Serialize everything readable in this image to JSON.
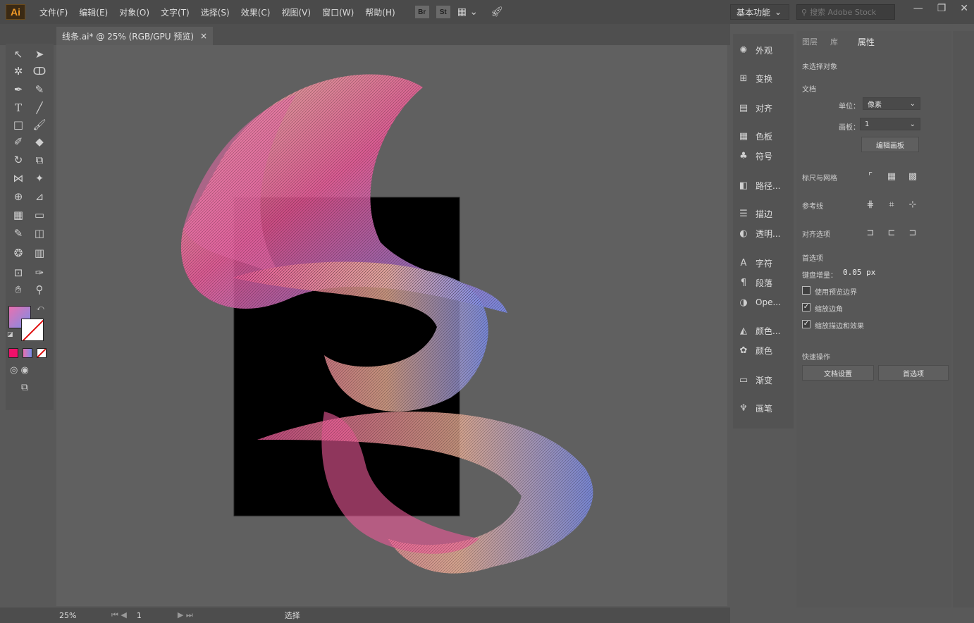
{
  "app": {
    "logo": "Ai"
  },
  "menu": [
    "文件(F)",
    "编辑(E)",
    "对象(O)",
    "文字(T)",
    "选择(S)",
    "效果(C)",
    "视图(V)",
    "窗口(W)",
    "帮助(H)"
  ],
  "menu_icons": {
    "br": "Br",
    "st": "St"
  },
  "workspace": {
    "label": "基本功能"
  },
  "search": {
    "placeholder": "搜索 Adobe Stock"
  },
  "document_tab": {
    "title": "线条.ai* @ 25% (RGB/GPU 预览)",
    "close": "×"
  },
  "status": {
    "zoom": "25%",
    "artboard": "1",
    "mode": "选择"
  },
  "dock": [
    {
      "icon": "appearance-icon",
      "label": "外观"
    },
    {
      "icon": "transform-icon",
      "label": "变换"
    },
    {
      "icon": "align-icon",
      "label": "对齐"
    },
    {
      "icon": "swatches-icon",
      "label": "色板"
    },
    {
      "icon": "symbols-icon",
      "label": "符号"
    },
    {
      "icon": "pathfinder-icon",
      "label": "路径..."
    },
    {
      "icon": "stroke-icon",
      "label": "描边"
    },
    {
      "icon": "transparency-icon",
      "label": "透明..."
    },
    {
      "icon": "character-icon",
      "label": "字符"
    },
    {
      "icon": "paragraph-icon",
      "label": "段落"
    },
    {
      "icon": "opentype-icon",
      "label": "Ope..."
    },
    {
      "icon": "color-guide-icon",
      "label": "颜色..."
    },
    {
      "icon": "color-icon",
      "label": "颜色"
    },
    {
      "icon": "gradient-icon",
      "label": "渐变"
    },
    {
      "icon": "brushes-icon",
      "label": "画笔"
    }
  ],
  "panel": {
    "tabs": [
      "图层",
      "库",
      "属性"
    ],
    "no_selection": "未选择对象",
    "document_section": "文档",
    "units_label": "单位：",
    "units_value": "像素",
    "artboard_label": "画板：",
    "artboard_value": "1",
    "edit_artboards": "编辑画板",
    "rulers_grids": "标尺与网格",
    "guides": "参考线",
    "snap_options": "对齐选项",
    "preferences_section": "首选项",
    "keyboard_increment_label": "键盘增量：",
    "keyboard_increment_value": "0.05 px",
    "use_preview_bounds": "使用预览边界",
    "scale_corners": "缩放边角",
    "scale_strokes": "缩放描边和效果",
    "quick_actions": "快速操作",
    "document_setup": "文档设置",
    "preferences_button": "首选项"
  },
  "colors": {
    "fill_start": "#e870b0",
    "fill_end": "#7a8ee8",
    "ribbon_peach": "#f2b49a",
    "ribbon_pink": "#ee5a9a",
    "ribbon_blue": "#7d8ff0",
    "artboard": "#000000"
  }
}
